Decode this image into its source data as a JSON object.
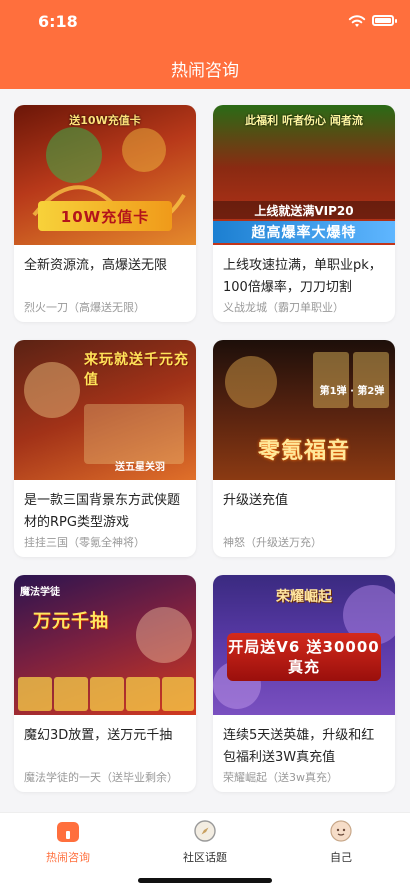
{
  "status_bar": {
    "time": "6:18"
  },
  "header": {
    "title": "热闹咨询"
  },
  "cards": [
    {
      "title": "全新资源流，高爆送无限",
      "subtitle": "烈火一刀（高爆送无限）",
      "banner": "10W充值卡",
      "band": "送10W充值卡",
      "colors": [
        "#6b1608",
        "#d8631a"
      ]
    },
    {
      "title": "上线攻速拉满，单职业pk，100倍爆率，刀刀切割",
      "subtitle": "义战龙城（霸刀单职业）",
      "banner": "超高爆率大爆特",
      "band": "上线就送满VIP20",
      "colors": [
        "#2a6b16",
        "#c2351a"
      ]
    },
    {
      "title": "是一款三国背景东方武侠题材的RPG类型游戏",
      "subtitle": "挂挂三国（零氪全神将）",
      "banner": "来玩就送千元充值",
      "band": "送五星关羽",
      "colors": [
        "#5a2214",
        "#c33d1f"
      ]
    },
    {
      "title": "升级送充值",
      "subtitle": "神怒（升级送万充）",
      "banner": "零氪福音",
      "band": "第1弹 · 第2弹",
      "colors": [
        "#1d0f0a",
        "#8b3a12"
      ]
    },
    {
      "title": "魔幻3D放置，送万元千抽",
      "subtitle": "魔法学徒的一天（送毕业剩余）",
      "banner": "万元千抽",
      "band": "魔法学徒",
      "colors": [
        "#2b1450",
        "#d23a1e"
      ]
    },
    {
      "title": "连续5天送英雄，升级和红包福利送3W真充值",
      "subtitle": "荣耀崛起（送3w真充）",
      "banner": "开局送V6 送30000真充",
      "band": "荣耀崛起",
      "colors": [
        "#3a2a80",
        "#7a50c0"
      ]
    }
  ],
  "tabbar": {
    "items": [
      {
        "label": "热闹咨询",
        "icon": "home-icon",
        "active": true
      },
      {
        "label": "社区话题",
        "icon": "compass-icon",
        "active": false
      },
      {
        "label": "自己",
        "icon": "face-icon",
        "active": false
      }
    ]
  },
  "colors": {
    "accent": "#ff6f3d",
    "background": "#f5f5f7"
  }
}
